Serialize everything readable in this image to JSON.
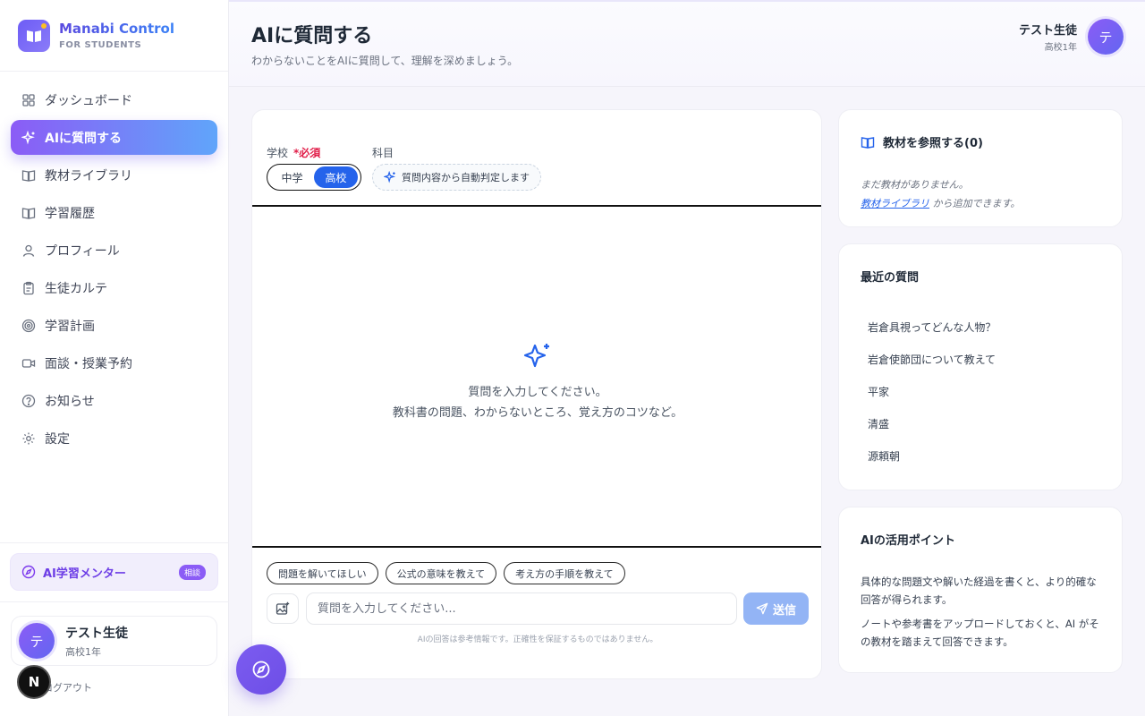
{
  "brand": {
    "name": "Manabi Control",
    "sub": "FOR STUDENTS"
  },
  "nav": [
    {
      "label": "ダッシュボード",
      "icon": "grid-icon"
    },
    {
      "label": "AIに質問する",
      "icon": "sparkle-icon",
      "active": true
    },
    {
      "label": "教材ライブラリ",
      "icon": "book-icon"
    },
    {
      "label": "学習履歴",
      "icon": "book-open-icon"
    },
    {
      "label": "プロフィール",
      "icon": "user-icon"
    },
    {
      "label": "生徒カルテ",
      "icon": "clipboard-icon"
    },
    {
      "label": "学習計画",
      "icon": "target-icon"
    },
    {
      "label": "面談・授業予約",
      "icon": "video-icon"
    },
    {
      "label": "お知らせ",
      "icon": "help-circle-icon"
    },
    {
      "label": "設定",
      "icon": "gear-icon"
    }
  ],
  "mentor": {
    "label": "AI学習メンター",
    "badge": "相談"
  },
  "user": {
    "name": "テスト生徒",
    "grade": "高校1年",
    "initial": "テ",
    "logout": "ログアウト"
  },
  "floating_badge": "N",
  "header": {
    "title": "AIに質問する",
    "subtitle": "わからないことをAIに質問して、理解を深めましょう。"
  },
  "form": {
    "school_label": "学校",
    "required_label": "*必須",
    "subject_label": "科目",
    "school_options": [
      "中学",
      "高校"
    ],
    "school_selected": "高校",
    "subject_auto": "質問内容から自動判定します"
  },
  "empty_state": {
    "line1": "質問を入力してください。",
    "line2": "教科書の問題、わからないところ、覚え方のコツなど。"
  },
  "suggestions": [
    "問題を解いてほしい",
    "公式の意味を教えて",
    "考え方の手順を教えて"
  ],
  "input": {
    "placeholder": "質問を入力してください..."
  },
  "send_label": "送信",
  "disclaimer": "AIの回答は参考情報です。正確性を保証するものではありません。",
  "materials": {
    "title": "教材を参照する(0)",
    "empty": "まだ教材がありません。",
    "link": "教材ライブラリ",
    "suffix": " から追加できます。"
  },
  "recent": {
    "title": "最近の質問",
    "items": [
      "岩倉具視ってどんな人物？",
      "岩倉使節団について教えて",
      "平家",
      "清盛",
      "源頼朝"
    ]
  },
  "tips": {
    "title": "AIの活用ポイント",
    "items": [
      "具体的な問題文や解いた経過を書くと、より的確な回答が得られます。",
      "ノートや参考書をアップロードしておくと、AI がその教材を踏まえて回答できます。"
    ]
  },
  "colors": {
    "accent": "#8b5cf6",
    "primary": "#2563eb",
    "send_disabled": "#93b4f5",
    "required": "#e11d48"
  }
}
